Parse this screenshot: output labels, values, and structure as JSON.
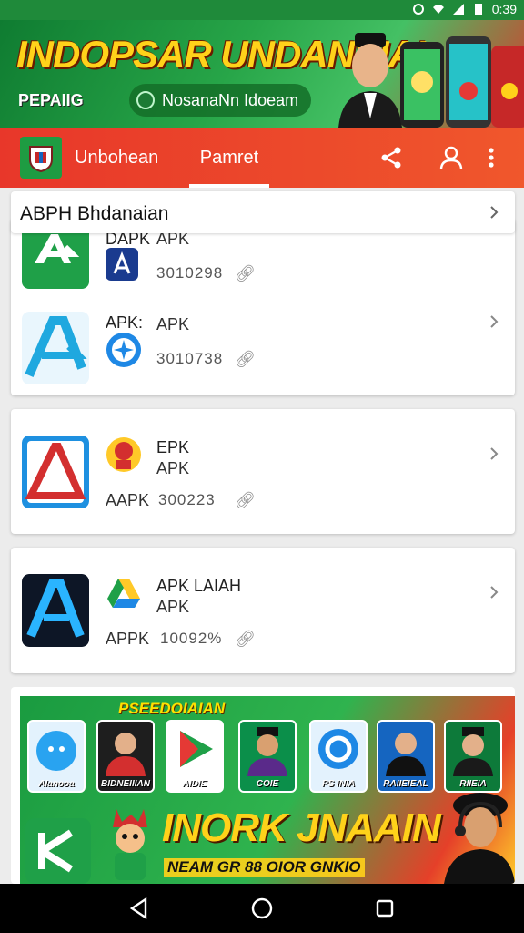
{
  "status_bar": {
    "time": "0:39"
  },
  "top_banner": {
    "title": "INDOPSAR UNDANSIAI",
    "subtitle": "PEPAIIG",
    "pill_text": "NosanaNn Idoeam"
  },
  "app_bar": {
    "tabs": [
      {
        "label": "Unbohean"
      },
      {
        "label": "Pamret",
        "active": true
      }
    ],
    "icons": [
      "share-icon",
      "profile-icon",
      "more-vert-icon"
    ]
  },
  "section": {
    "title": "ABPH Bhdanaian"
  },
  "cards": [
    {
      "rows": [
        {
          "label_a": "DAPK",
          "label_b": "APK",
          "number": "3010298"
        },
        {
          "label_a": "APK:",
          "label_b": "APK",
          "number": "3010738"
        }
      ]
    },
    {
      "rows": [
        {
          "label_a": "EPK",
          "label_b": "APK",
          "prefix": "AAPK",
          "number": "300223"
        }
      ]
    },
    {
      "rows": [
        {
          "label_a": "APK LAIAH",
          "label_b": "APK",
          "prefix": "APPK",
          "number": "10092%"
        }
      ]
    }
  ],
  "promo": {
    "heading": "PSEEDOIAIAN",
    "tiles": [
      {
        "label": "AIanooa",
        "color": "#1e88e5"
      },
      {
        "label": "BIDNEIIIAN",
        "color": "#2a2a2a"
      },
      {
        "label": "AIDIE",
        "color": "#e53935"
      },
      {
        "label": "COIE",
        "color": "#0b8f4a"
      },
      {
        "label": "PS INIA",
        "color": "#ffffff"
      },
      {
        "label": "RAIIEIEAL",
        "color": "#1565c0"
      },
      {
        "label": "RIIEIA",
        "color": "#0d7a3a"
      }
    ],
    "title": "INORK JNAAIN",
    "subtitle": "NEAM GR 88 OIOR GNKIO"
  },
  "colors": {
    "green": "#1f9c43",
    "red": "#e8372a",
    "gold": "#ffd21a"
  }
}
